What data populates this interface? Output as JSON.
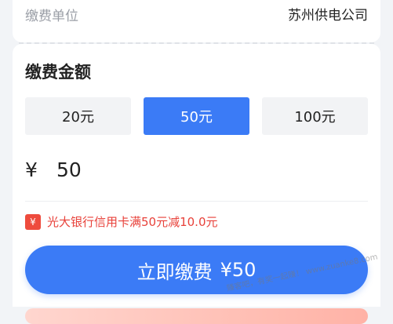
{
  "payment_unit": {
    "label": "缴费单位",
    "value": "苏州供电公司"
  },
  "amount_section": {
    "title": "缴费金额",
    "options": [
      {
        "label": "20元",
        "selected": false
      },
      {
        "label": "50元",
        "selected": true
      },
      {
        "label": "100元",
        "selected": false
      }
    ],
    "currency_symbol": "¥",
    "value": "50"
  },
  "promo": {
    "icon": "yen-icon",
    "icon_text": "¥",
    "text": "光大银行信用卡满50元减10.0元"
  },
  "pay_button": {
    "label": "立即缴费",
    "amount": "¥50"
  },
  "watermark": {
    "text": "赚客吧，有奖一起赚！ www.zuanke8.com"
  },
  "colors": {
    "accent": "#3b7bf6",
    "promo_red": "#e8413a"
  }
}
